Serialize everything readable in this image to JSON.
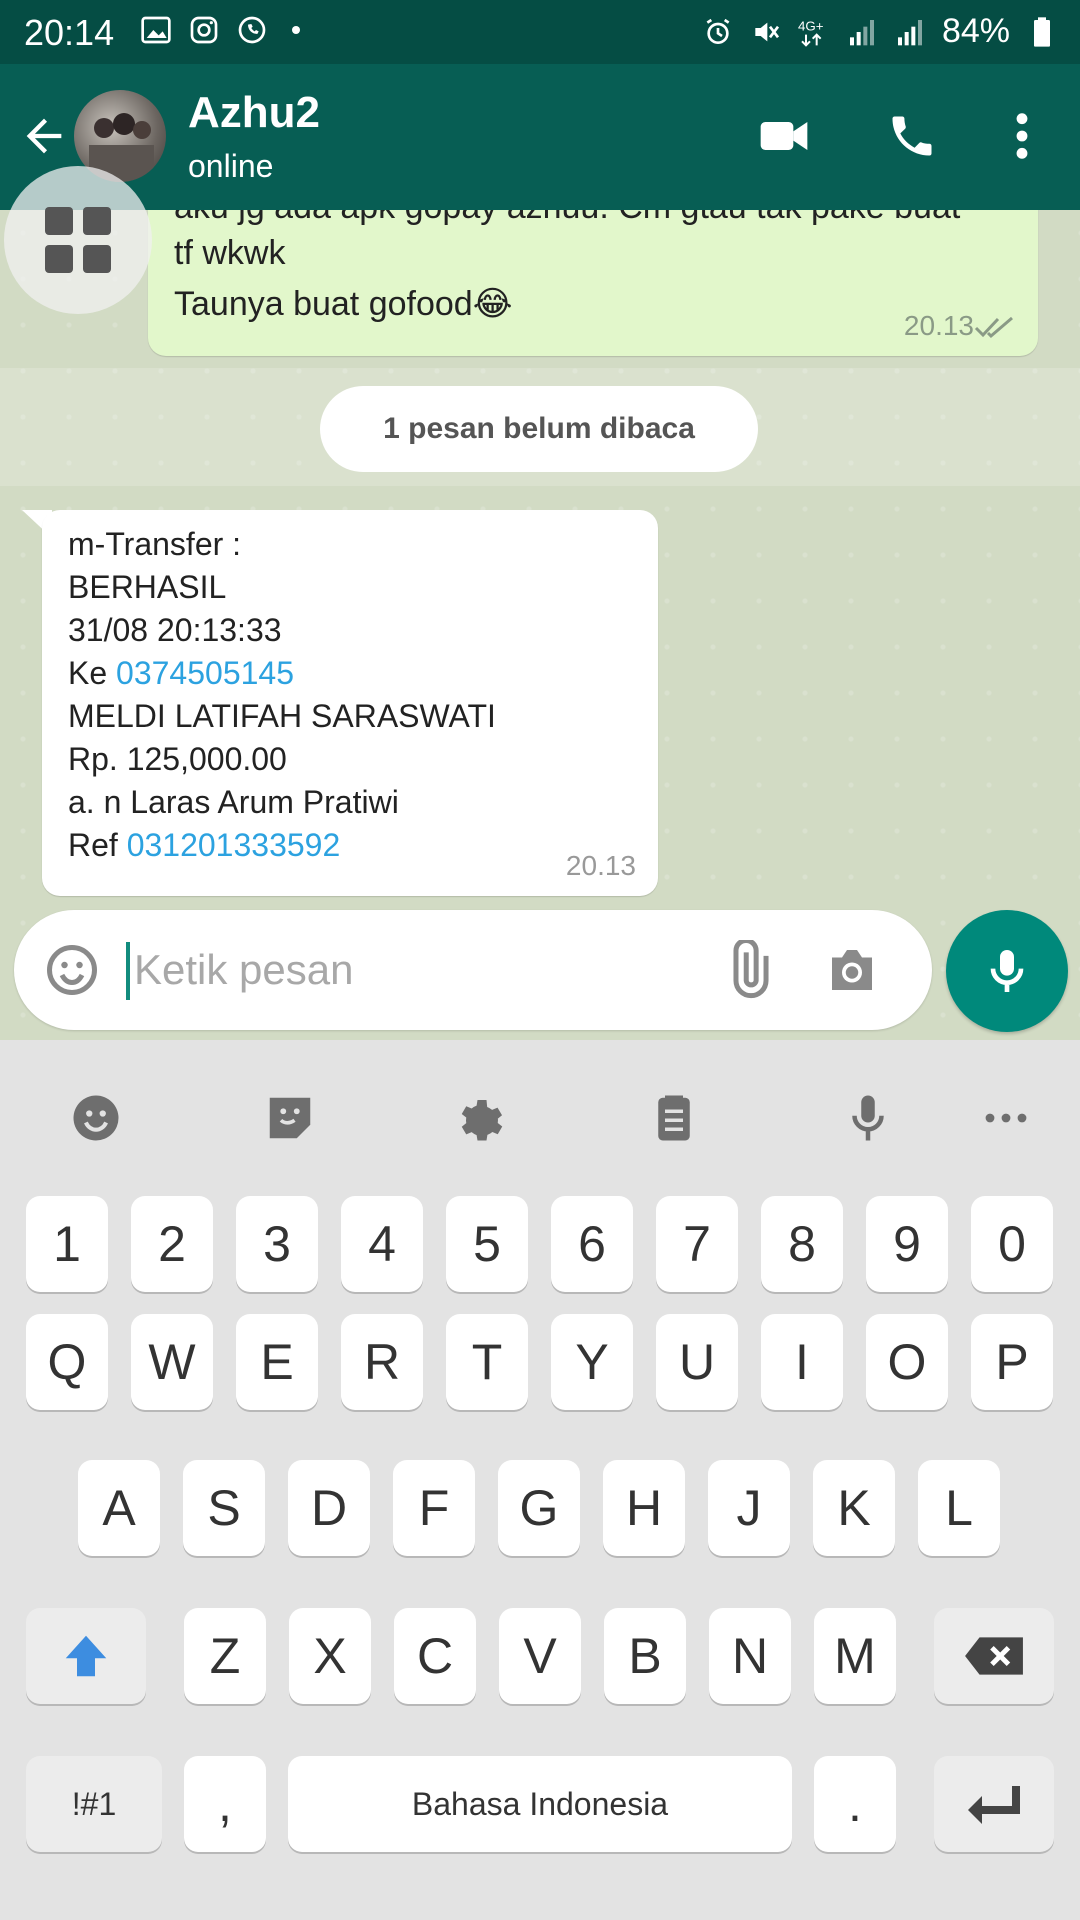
{
  "status_bar": {
    "time": "20:14",
    "battery": "84%",
    "network": "4G+"
  },
  "chat_header": {
    "name": "Azhu2",
    "status": "online"
  },
  "outgoing_message": {
    "line1": "aku jg ada apk gopay azhuu. Cm gtau tak pake buat",
    "line2": "tf wkwk",
    "line3": "Taunya buat gofood😂",
    "time": "20.13"
  },
  "unread_banner": "1 pesan belum dibaca",
  "incoming_message": {
    "lines": [
      {
        "text": "m-Transfer :"
      },
      {
        "text": "BERHASIL"
      },
      {
        "text": "31/08 20:13:33"
      },
      {
        "prefix": "Ke ",
        "link": "0374505145"
      },
      {
        "text": "MELDI LATIFAH SARASWATI"
      },
      {
        "text": "Rp. 125,000.00"
      },
      {
        "text": "a. n Laras Arum Pratiwi"
      },
      {
        "prefix": "Ref ",
        "link": "031201333592"
      }
    ],
    "time": "20.13"
  },
  "composer": {
    "placeholder": "Ketik pesan"
  },
  "keyboard": {
    "row_numbers": [
      "1",
      "2",
      "3",
      "4",
      "5",
      "6",
      "7",
      "8",
      "9",
      "0"
    ],
    "row_q": [
      "Q",
      "W",
      "E",
      "R",
      "T",
      "Y",
      "U",
      "I",
      "O",
      "P"
    ],
    "row_a": [
      "A",
      "S",
      "D",
      "F",
      "G",
      "H",
      "J",
      "K",
      "L"
    ],
    "row_z": [
      "Z",
      "X",
      "C",
      "V",
      "B",
      "N",
      "M"
    ],
    "symbols_label": "!#1",
    "comma": ",",
    "space_label": "Bahasa Indonesia",
    "period": "."
  },
  "colors": {
    "header": "#075e54",
    "status_bar": "#054d44",
    "outgoing_bubble": "#e2f7cb",
    "link": "#2ca2e0",
    "fab": "#00897b"
  }
}
